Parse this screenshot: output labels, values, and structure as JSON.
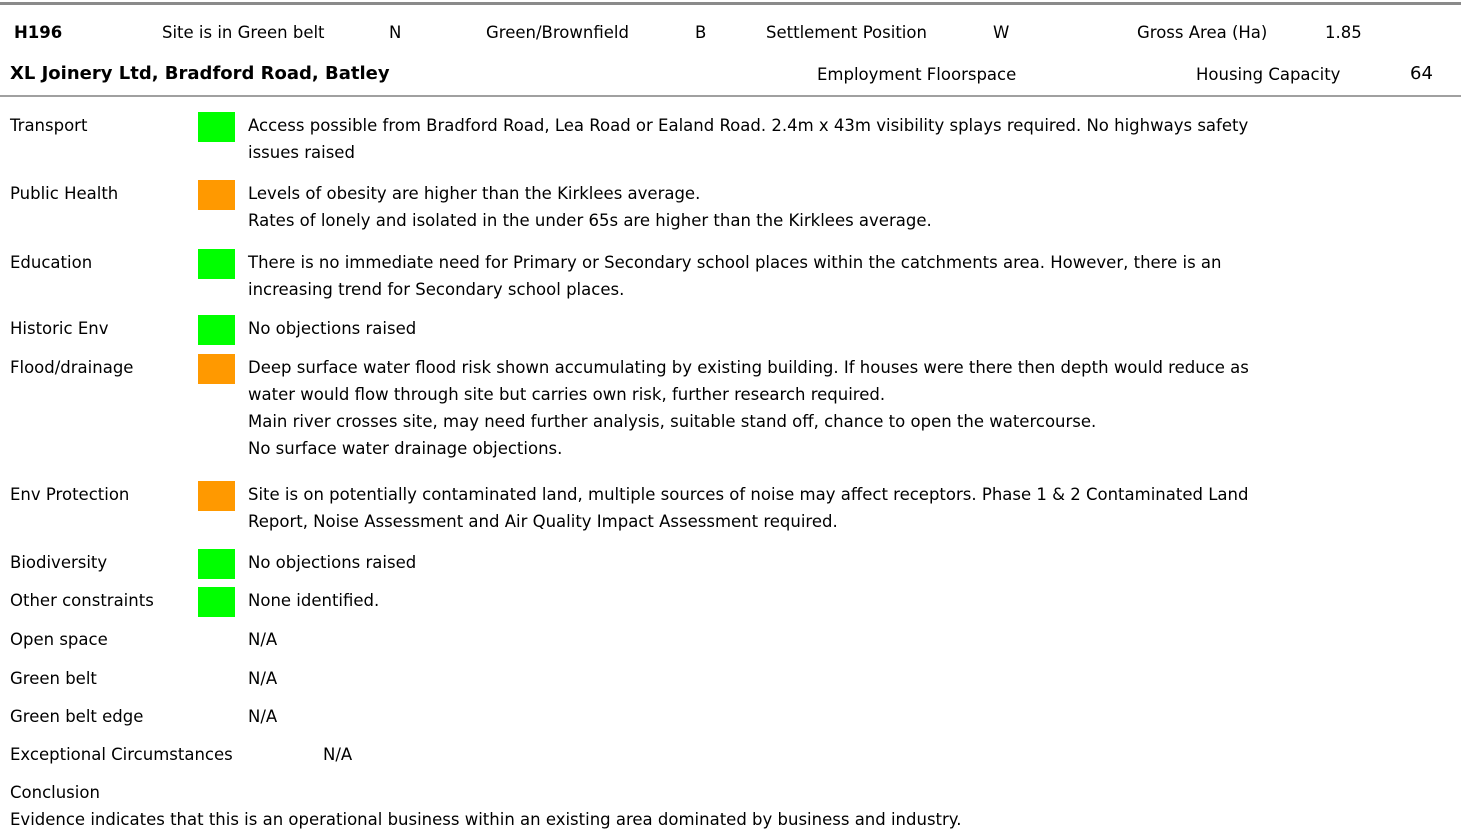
{
  "header": {
    "site_ref": "H196",
    "green_belt_label": "Site is in Green belt",
    "green_belt_value": "N",
    "green_brownfield_label": "Green/Brownfield",
    "green_brownfield_value": "B",
    "settlement_position_label": "Settlement Position",
    "settlement_position_value": "W",
    "gross_area_label": "Gross Area (Ha)",
    "gross_area_value": "1.85",
    "site_name": "XL Joinery Ltd, Bradford Road, Batley",
    "employment_floorspace_label": "Employment Floorspace",
    "housing_capacity_label": "Housing Capacity",
    "housing_capacity_value": "64"
  },
  "rating_colors": {
    "green": "#00ff00",
    "amber": "#ff9900"
  },
  "rows": [
    {
      "label": "Transport",
      "rating": "green",
      "lines": [
        "Access possible from Bradford Road, Lea Road or Ealand Road. 2.4m x 43m visibility splays required. No highways safety",
        "issues raised"
      ]
    },
    {
      "label": "Public Health",
      "rating": "amber",
      "lines": [
        "Levels of obesity are higher than the Kirklees average.",
        "Rates of lonely and isolated in the under 65s are higher than the Kirklees average."
      ]
    },
    {
      "label": "Education",
      "rating": "green",
      "lines": [
        "There is no immediate need for Primary or Secondary school places within the catchments area. However, there is an",
        "increasing trend for Secondary school places."
      ]
    },
    {
      "label": "Historic Env",
      "rating": "green",
      "lines": [
        "No objections raised"
      ]
    },
    {
      "label": "Flood/drainage",
      "rating": "amber",
      "lines": [
        "Deep surface water flood risk shown accumulating by existing building. If houses were there then depth would reduce as",
        "water would flow through site but carries own risk, further research required.",
        "Main river crosses site, may need further analysis, suitable stand off, chance to open the watercourse.",
        "No surface water drainage objections."
      ]
    },
    {
      "label": "Env Protection",
      "rating": "amber",
      "lines": [
        "Site is on potentially contaminated land, multiple sources of noise may affect receptors. Phase 1 & 2 Contaminated Land",
        "Report, Noise Assessment and Air Quality Impact Assessment required."
      ]
    },
    {
      "label": "Biodiversity",
      "rating": "green",
      "lines": [
        "No objections raised"
      ]
    },
    {
      "label": "Other constraints",
      "rating": "green",
      "lines": [
        "None identified."
      ]
    },
    {
      "label": "Open space",
      "rating": "",
      "lines": [
        "N/A"
      ]
    },
    {
      "label": "Green belt",
      "rating": "",
      "lines": [
        "N/A"
      ]
    },
    {
      "label": "Green belt edge",
      "rating": "",
      "lines": [
        "N/A"
      ]
    }
  ],
  "exceptional": {
    "label": "Exceptional Circumstances",
    "value": "N/A"
  },
  "conclusion": {
    "label": "Conclusion",
    "text": "Evidence indicates that this is an operational business within an existing area dominated by business and industry."
  }
}
